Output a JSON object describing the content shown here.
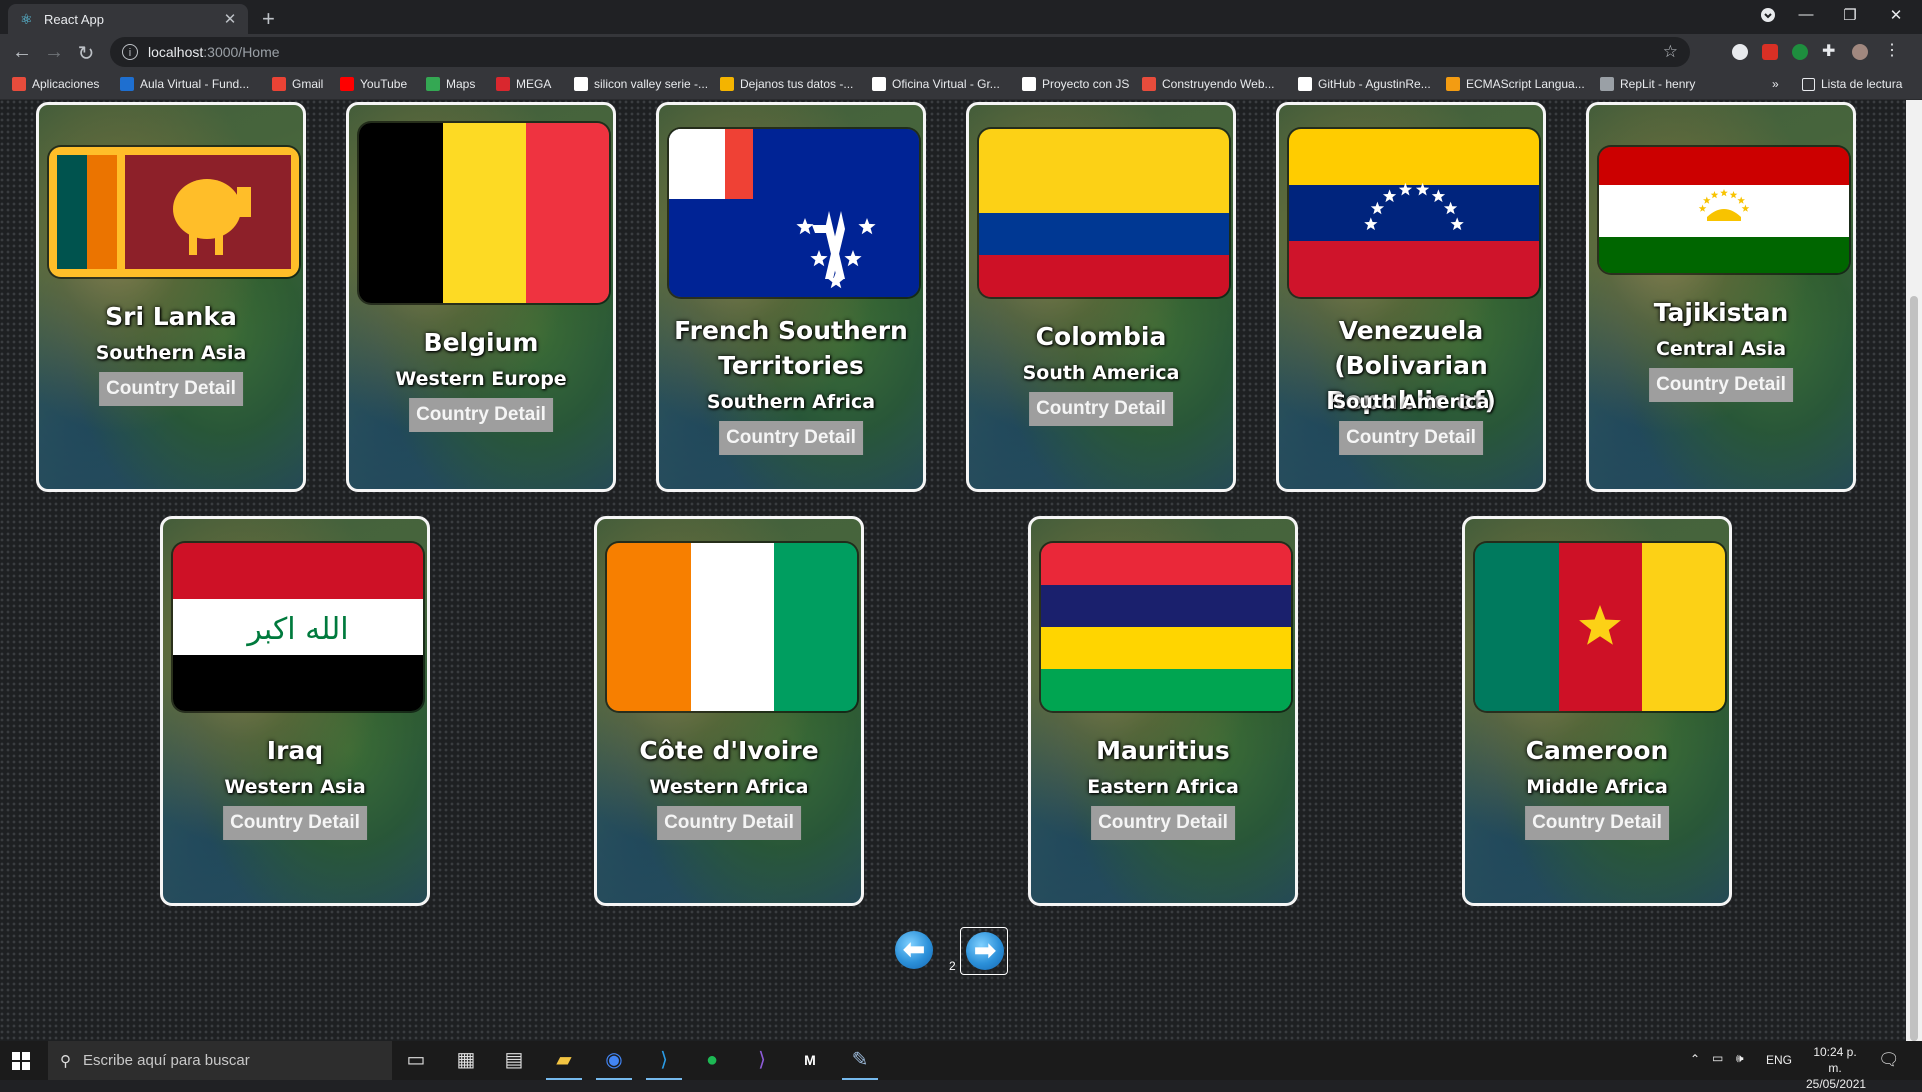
{
  "browser": {
    "tab_title": "React App",
    "url_host": "localhost",
    "url_path": ":3000/Home",
    "bookmarks": [
      {
        "label": "Aplicaciones",
        "color": "#e74c3c"
      },
      {
        "label": "Aula Virtual - Fund...",
        "color": "#1e6fd0"
      },
      {
        "label": "Gmail",
        "color": "#ea4335"
      },
      {
        "label": "YouTube",
        "color": "#ff0000"
      },
      {
        "label": "Maps",
        "color": "#34a853"
      },
      {
        "label": "MEGA",
        "color": "#d9272e"
      },
      {
        "label": "silicon valley serie -...",
        "color": "#ffffff"
      },
      {
        "label": "Dejanos tus datos -...",
        "color": "#f4b400"
      },
      {
        "label": "Oficina Virtual - Gr...",
        "color": "#ffffff"
      },
      {
        "label": "Proyecto con JS",
        "color": "#ffffff"
      },
      {
        "label": "Construyendo Web...",
        "color": "#e74c3c"
      },
      {
        "label": "GitHub - AgustinRe...",
        "color": "#ffffff"
      },
      {
        "label": "ECMAScript Langua...",
        "color": "#f39c12"
      },
      {
        "label": "RepLit - henry",
        "color": "#9aa0a6"
      }
    ],
    "reading_list": "Lista de lectura"
  },
  "countries": [
    {
      "name": "Sri Lanka",
      "region": "Southern Asia",
      "flag": "sri-lanka"
    },
    {
      "name": "Belgium",
      "region": "Western Europe",
      "flag": "belgium"
    },
    {
      "name": "French Southern Territories",
      "region": "Southern Africa",
      "flag": "french-southern"
    },
    {
      "name": "Colombia",
      "region": "South America",
      "flag": "colombia"
    },
    {
      "name": "Venezuela (Bolivarian Republic of)",
      "region": "South America",
      "flag": "venezuela"
    },
    {
      "name": "Tajikistan",
      "region": "Central Asia",
      "flag": "tajikistan"
    },
    {
      "name": "Iraq",
      "region": "Western Asia",
      "flag": "iraq"
    },
    {
      "name": "Côte d'Ivoire",
      "region": "Western Africa",
      "flag": "cote-divoire"
    },
    {
      "name": "Mauritius",
      "region": "Eastern Africa",
      "flag": "mauritius"
    },
    {
      "name": "Cameroon",
      "region": "Middle Africa",
      "flag": "cameroon"
    }
  ],
  "detail_label": "Country Detail",
  "pagination": {
    "page": "2"
  },
  "taskbar": {
    "search_placeholder": "Escribe aquí para buscar",
    "language": "ENG",
    "time": "10:24 p. m.",
    "date": "25/05/2021"
  },
  "colors": {
    "accent": "#2b90d9",
    "button": "#9e9e9e"
  }
}
